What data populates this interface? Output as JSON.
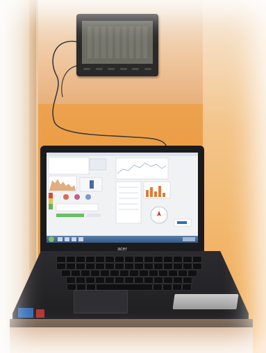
{
  "scene": {
    "description_tokens": [
      "weather-station",
      "laptop",
      "cables",
      "wall"
    ],
    "colors": {
      "wall_orange": "#e99638",
      "wall_peach": "#efc79f",
      "laptop_body": "#1b1b1d",
      "screen_bg": "#f0f2f4",
      "taskbar": "#355a86"
    },
    "laptop": {
      "brand": "acer"
    }
  }
}
